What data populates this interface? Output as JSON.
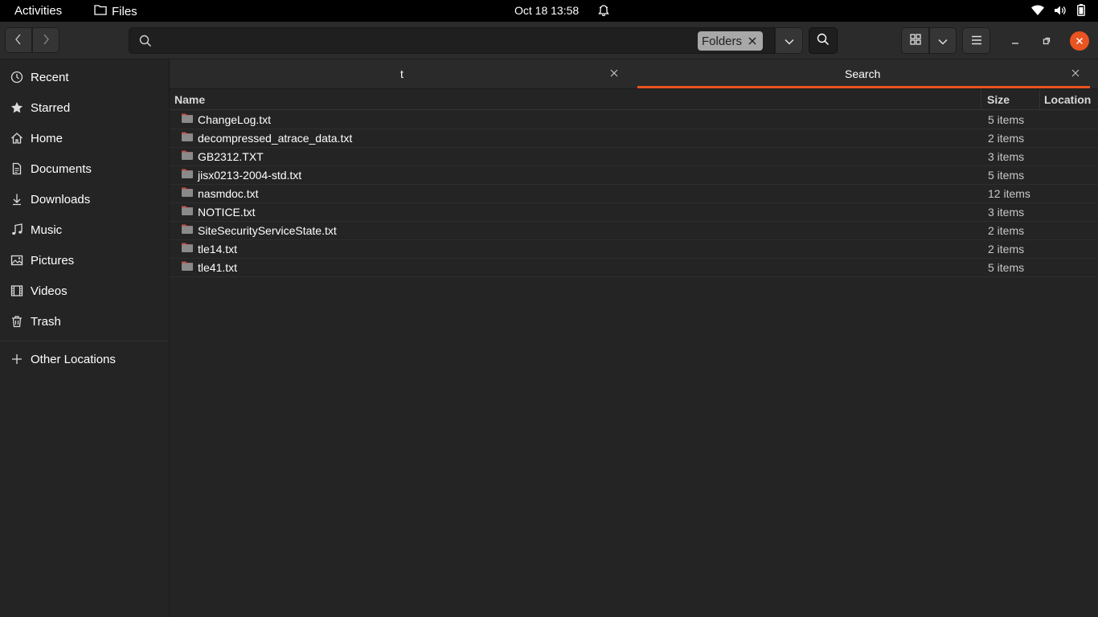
{
  "topbar": {
    "activities": "Activities",
    "app_name": "Files",
    "clock": "Oct 18  13:58"
  },
  "header": {
    "search_value": "",
    "filter_chip": "Folders"
  },
  "sidebar": {
    "items": [
      {
        "label": "Recent",
        "icon": "clock-icon"
      },
      {
        "label": "Starred",
        "icon": "star-icon"
      },
      {
        "label": "Home",
        "icon": "home-icon"
      },
      {
        "label": "Documents",
        "icon": "document-icon"
      },
      {
        "label": "Downloads",
        "icon": "download-icon"
      },
      {
        "label": "Music",
        "icon": "music-icon"
      },
      {
        "label": "Pictures",
        "icon": "picture-icon"
      },
      {
        "label": "Videos",
        "icon": "video-icon"
      },
      {
        "label": "Trash",
        "icon": "trash-icon"
      }
    ],
    "other_locations": "Other Locations"
  },
  "tabs": [
    {
      "label": "t",
      "active": false
    },
    {
      "label": "Search",
      "active": true
    }
  ],
  "columns": {
    "name": "Name",
    "size": "Size",
    "location": "Location"
  },
  "rows": [
    {
      "name": "ChangeLog.txt",
      "size": "5 items"
    },
    {
      "name": "decompressed_atrace_data.txt",
      "size": "2 items"
    },
    {
      "name": "GB2312.TXT",
      "size": "3 items"
    },
    {
      "name": "jisx0213-2004-std.txt",
      "size": "5 items"
    },
    {
      "name": "nasmdoc.txt",
      "size": "12 items"
    },
    {
      "name": "NOTICE.txt",
      "size": "3 items"
    },
    {
      "name": "SiteSecurityServiceState.txt",
      "size": "2 items"
    },
    {
      "name": "tle14.txt",
      "size": "2 items"
    },
    {
      "name": "tle41.txt",
      "size": "5 items"
    }
  ],
  "colors": {
    "accent": "#e95420",
    "background": "#242424",
    "folder": "#8a8a8a",
    "folder_tab": "#c0504d"
  }
}
